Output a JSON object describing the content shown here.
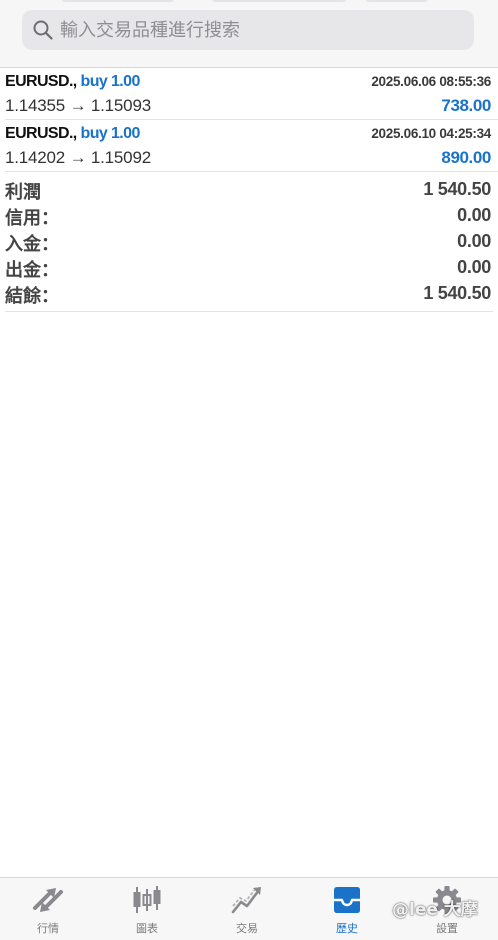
{
  "search": {
    "placeholder": "輸入交易品種進行搜索"
  },
  "deals": [
    {
      "symbol": "EURUSD.,",
      "side": "buy 1.00",
      "time": "2025.06.06 08:55:36",
      "prices": "1.14355 → 1.15093",
      "profit": "738.00"
    },
    {
      "symbol": "EURUSD.,",
      "side": "buy 1.00",
      "time": "2025.06.10 04:25:34",
      "prices": "1.14202 → 1.15092",
      "profit": "890.00"
    }
  ],
  "summary": [
    {
      "label": "利潤",
      "value": "1 540.50"
    },
    {
      "label": "信用：",
      "value": "0.00"
    },
    {
      "label": "入金：",
      "value": "0.00"
    },
    {
      "label": "出金：",
      "value": "0.00"
    },
    {
      "label": "結餘：",
      "value": "1 540.50"
    }
  ],
  "tabs": [
    {
      "label": "行情",
      "icon": "quotes-icon",
      "active": false
    },
    {
      "label": "圖表",
      "icon": "chart-icon",
      "active": false
    },
    {
      "label": "交易",
      "icon": "trade-icon",
      "active": false
    },
    {
      "label": "歷史",
      "icon": "history-icon",
      "active": true
    },
    {
      "label": "設置",
      "icon": "settings-icon",
      "active": false
    }
  ],
  "watermark": "@lee 大摩",
  "colors": {
    "accent": "#1a73c9",
    "inactive": "#7a7a7e",
    "text": "#444444"
  }
}
